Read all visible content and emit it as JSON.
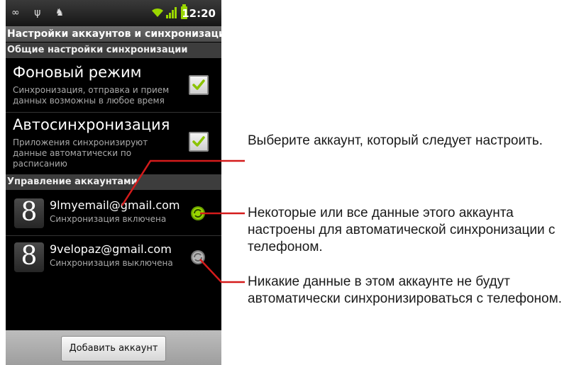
{
  "statusbar": {
    "time": "12:20",
    "left_icons": "∞ ψ ♞"
  },
  "screen": {
    "title": "Настройки аккаунтов и синхронизации"
  },
  "general_section": {
    "header": "Общие настройки синхронизации",
    "items": [
      {
        "title": "Фоновый режим",
        "subtitle": "Синхронизация, отправка и прием данных возможны в любое время",
        "checked": true
      },
      {
        "title": "Автосинхронизация",
        "subtitle": "Приложения синхронизируют данные автоматически по расписанию",
        "checked": true
      }
    ]
  },
  "accounts_section": {
    "header": "Управление аккаунтами",
    "accounts": [
      {
        "logo": "8",
        "email": "9lmyemail@gmail.com",
        "status": "Синхронизация включена",
        "sync_icon": "sync-on-icon"
      },
      {
        "logo": "8",
        "email": "9velopaz@gmail.com",
        "status": "Синхронизация выключена",
        "sync_icon": "sync-off-icon"
      }
    ]
  },
  "add_account_button": "Добавить аккаунт",
  "callouts": [
    "Выберите аккаунт, который следует настроить.",
    "Некоторые или все данные этого аккаунта настроены для автоматической синхронизации с телефоном.",
    "Никакие данные в этом аккаунте не будут автоматически синхронизироваться с телефоном."
  ],
  "colors": {
    "accent_green": "#9ad700",
    "callout_line": "#d41b1b",
    "sync_off": "#9a9a9a"
  }
}
